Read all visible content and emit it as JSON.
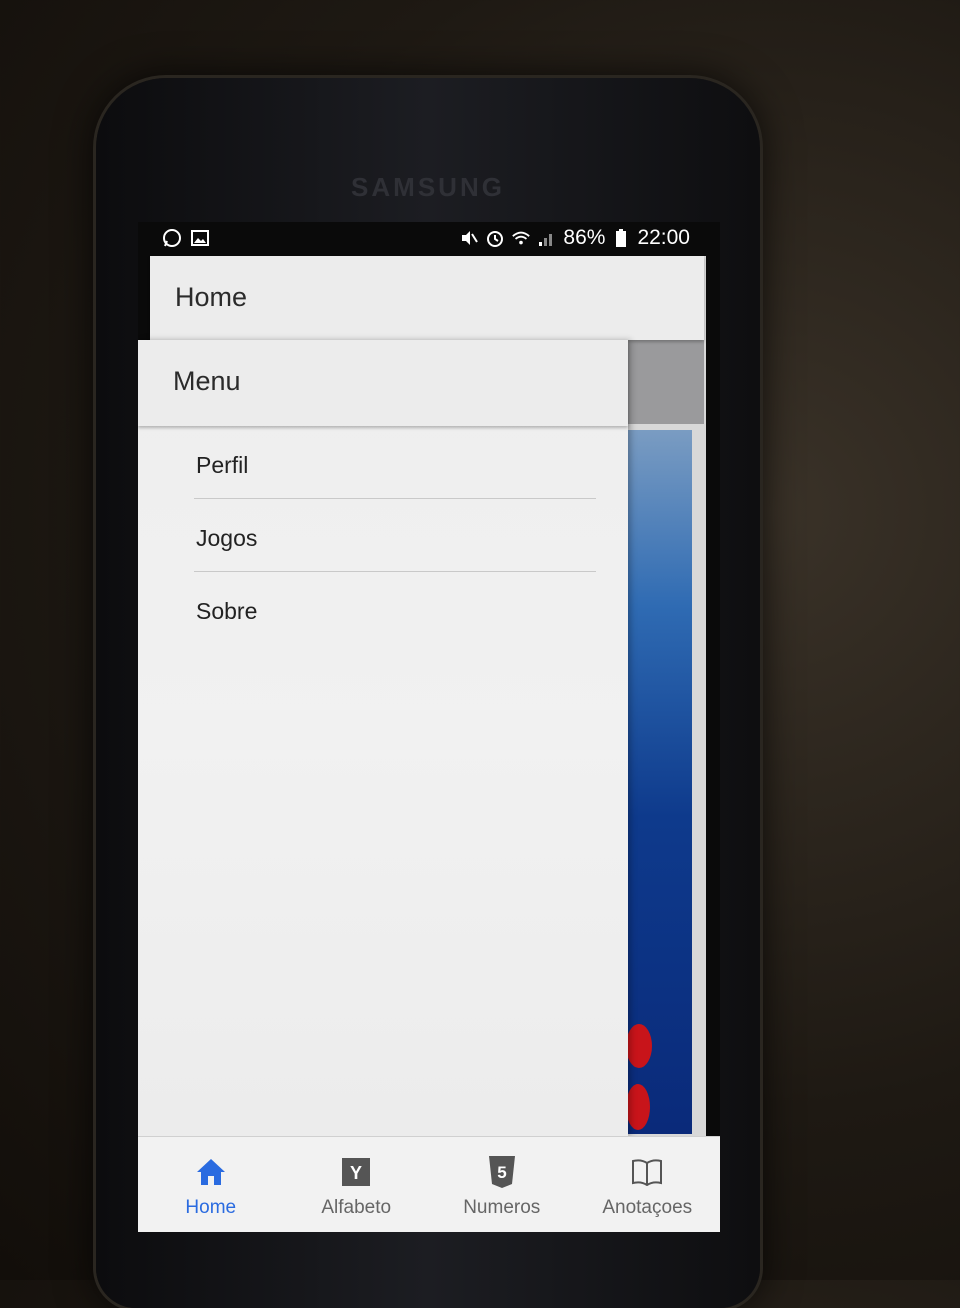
{
  "device": {
    "brand": "SAMSUNG"
  },
  "status_bar": {
    "battery": "86%",
    "time": "22:00",
    "left_icons": [
      "whatsapp-icon",
      "image-icon"
    ],
    "right_icons": [
      "mute-icon",
      "alarm-icon",
      "wifi-icon",
      "signal-icon",
      "battery-icon"
    ]
  },
  "app_header": {
    "title": "Home"
  },
  "drawer": {
    "title": "Menu",
    "items": [
      {
        "label": "Perfil"
      },
      {
        "label": "Jogos"
      },
      {
        "label": "Sobre"
      }
    ]
  },
  "tabbar": {
    "tabs": [
      {
        "label": "Home",
        "icon": "home-icon",
        "active": true
      },
      {
        "label": "Alfabeto",
        "icon": "y-letter-icon",
        "active": false
      },
      {
        "label": "Numeros",
        "icon": "html5-icon",
        "active": false
      },
      {
        "label": "Anotaçoes",
        "icon": "book-icon",
        "active": false
      }
    ]
  },
  "colors": {
    "accent": "#2a6be0",
    "drawer_bg": "#eeeeee",
    "tab_inactive": "#666666"
  }
}
